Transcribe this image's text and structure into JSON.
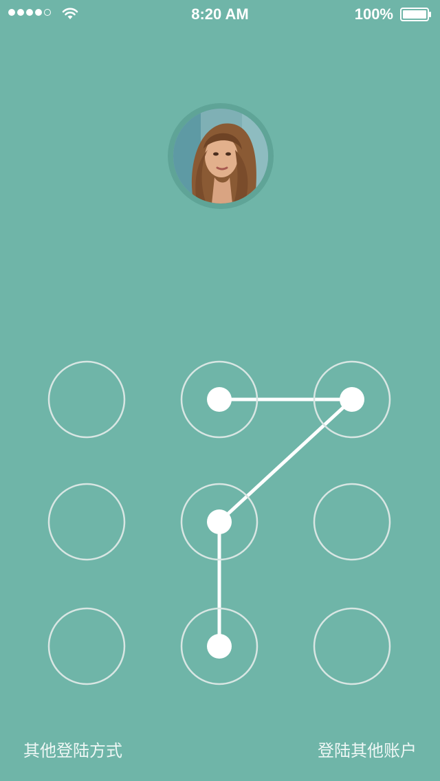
{
  "status_bar": {
    "time": "8:20 AM",
    "battery": "100%",
    "signal_dots": [
      true,
      true,
      true,
      true,
      false
    ]
  },
  "avatar": {
    "icon": "user-photo"
  },
  "pattern": {
    "selected_nodes": [
      1,
      2,
      4,
      7
    ],
    "line_color": "#ffffff",
    "ring_color": "#d8e6e3"
  },
  "footer": {
    "other_login_method": "其他登陆方式",
    "login_other_account": "登陆其他账户"
  },
  "colors": {
    "background": "#6fb5a8",
    "text": "#ffffff"
  }
}
